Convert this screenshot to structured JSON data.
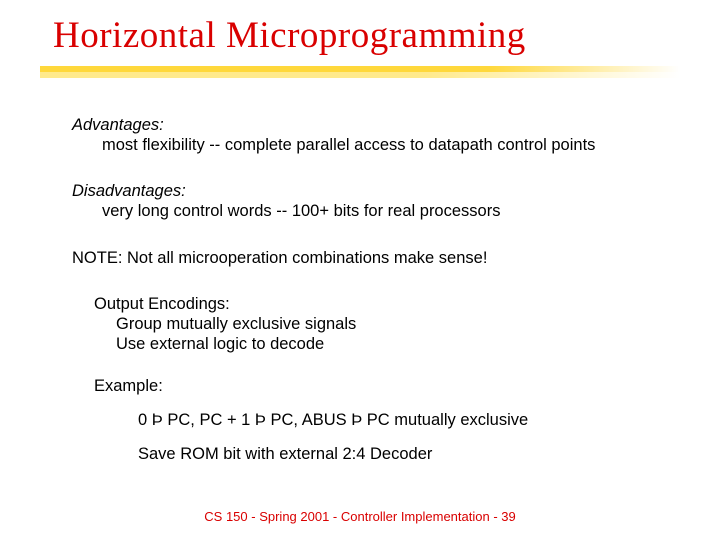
{
  "title": "Horizontal Microprogramming",
  "adv": {
    "label": "Advantages:",
    "line": "most flexibility -- complete parallel access to datapath control points"
  },
  "dis": {
    "label": "Disadvantages:",
    "line": "very long control words -- 100+ bits for real processors"
  },
  "note": "NOTE:  Not all microoperation combinations make sense!",
  "enc": {
    "label": "Output Encodings:",
    "l1": "Group mutually exclusive signals",
    "l2": "Use external logic to decode"
  },
  "example": {
    "label": "Example:",
    "l1": "0 Þ PC, PC + 1 Þ PC, ABUS Þ PC mutually exclusive",
    "l2": "Save ROM bit with external 2:4 Decoder"
  },
  "footer": "CS 150 - Spring 2001 - Controller Implementation - 39"
}
